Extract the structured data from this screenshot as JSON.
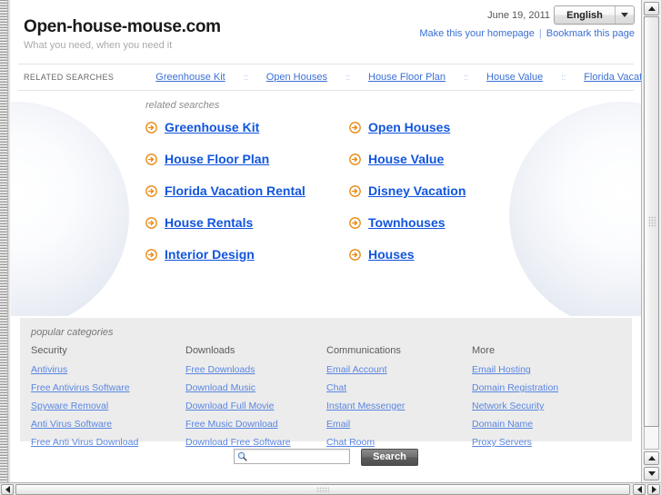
{
  "header": {
    "site_title": "Open-house-mouse.com",
    "tagline": "What you need, when you need it",
    "date": "June 19, 2011",
    "language_selected": "English",
    "language_arrow_icon": "chevron-down-icon",
    "homepage_link": "Make this your homepage",
    "separator": "|",
    "bookmark_link": "Bookmark this page"
  },
  "relbar": {
    "label": "RELATED SEARCHES",
    "dots": "::",
    "items": [
      {
        "label": "Greenhouse Kit"
      },
      {
        "label": "Open Houses"
      },
      {
        "label": "House Floor Plan"
      },
      {
        "label": "House Value"
      },
      {
        "label": "Florida Vacation Rental"
      }
    ]
  },
  "main": {
    "caption": "related searches",
    "arrow_icon": "circle-arrow-right-icon",
    "links": [
      {
        "label": "Greenhouse Kit"
      },
      {
        "label": "Open Houses"
      },
      {
        "label": "House Floor Plan"
      },
      {
        "label": "House Value"
      },
      {
        "label": "Florida Vacation Rental"
      },
      {
        "label": "Disney Vacation"
      },
      {
        "label": "House Rentals"
      },
      {
        "label": "Townhouses"
      },
      {
        "label": "Interior Design"
      },
      {
        "label": "Houses"
      }
    ]
  },
  "categories": {
    "caption": "popular categories",
    "columns": [
      {
        "title": "Security",
        "links": [
          "Antivirus",
          "Free Antivirus Software",
          "Spyware Removal",
          "Anti Virus Software",
          "Free Anti Virus Download"
        ]
      },
      {
        "title": "Downloads",
        "links": [
          "Free Downloads",
          "Download Music",
          "Download Full Movie",
          "Free Music Download",
          "Download Free Software"
        ]
      },
      {
        "title": "Communications",
        "links": [
          "Email Account",
          "Chat",
          "Instant Messenger",
          "Email",
          "Chat Room"
        ]
      },
      {
        "title": "More",
        "links": [
          "Email Hosting",
          "Domain Registration",
          "Network Security",
          "Domain Name",
          "Proxy Servers"
        ]
      }
    ]
  },
  "search": {
    "value": "",
    "placeholder": "",
    "icon": "magnifier-icon",
    "button_label": "Search"
  },
  "scrollbars": {
    "vertical_up_icon": "triangle-up-icon",
    "vertical_down_icon": "triangle-down-icon",
    "horizontal_left_icon": "triangle-left-icon",
    "horizontal_right_icon": "triangle-right-icon"
  },
  "colors": {
    "link_blue": "#1155dd",
    "nav_blue": "#3b6fd4",
    "cat_link_blue": "#5a86e0",
    "arrow_orange": "#e8880d",
    "panel_grey": "#ececec",
    "button_grey": "#5c5c5c"
  }
}
